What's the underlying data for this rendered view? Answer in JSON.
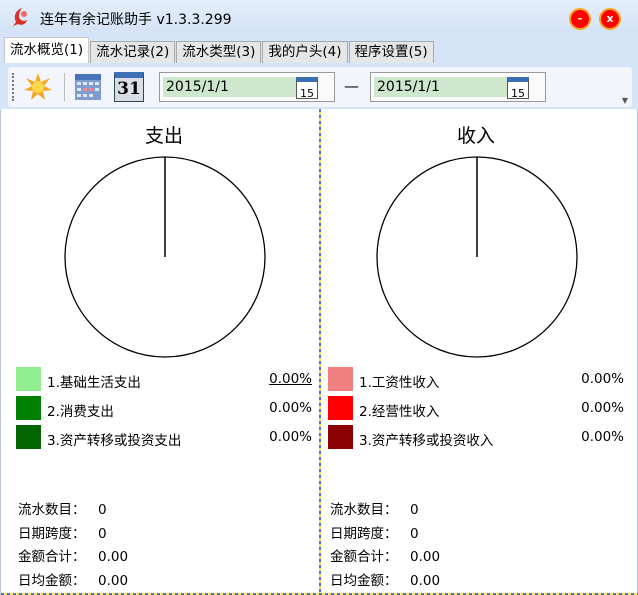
{
  "window": {
    "title": "连年有余记账助手 v1.3.3.299",
    "minimize": "-",
    "close": "x"
  },
  "tabs": [
    {
      "label": "流水概览(1)"
    },
    {
      "label": "流水记录(2)"
    },
    {
      "label": "流水类型(3)"
    },
    {
      "label": "我的户头(4)"
    },
    {
      "label": "程序设置(5)"
    }
  ],
  "toolbar": {
    "start_date": "2015/1/1",
    "end_date": "2015/1/1",
    "separator": "—",
    "cal_icon_text": "15",
    "cal31": "31"
  },
  "expense": {
    "title": "支出",
    "items": [
      {
        "label": "1.基础生活支出",
        "pct": "0.00%",
        "color": "#90ee90"
      },
      {
        "label": "2.消费支出",
        "pct": "0.00%",
        "color": "#008000"
      },
      {
        "label": "3.资产转移或投资支出",
        "pct": "0.00%",
        "color": "#006400"
      }
    ],
    "stats": [
      {
        "k": "流水数目：",
        "v": "0"
      },
      {
        "k": "日期跨度：",
        "v": "0"
      },
      {
        "k": "金额合计：",
        "v": "0.00"
      },
      {
        "k": "日均金额：",
        "v": "0.00"
      }
    ]
  },
  "income": {
    "title": "收入",
    "items": [
      {
        "label": "1.工资性收入",
        "pct": "0.00%",
        "color": "#f08080"
      },
      {
        "label": "2.经营性收入",
        "pct": "0.00%",
        "color": "#ff0000"
      },
      {
        "label": "3.资产转移或投资收入",
        "pct": "0.00%",
        "color": "#8b0000"
      }
    ],
    "stats": [
      {
        "k": "流水数目：",
        "v": "0"
      },
      {
        "k": "日期跨度：",
        "v": "0"
      },
      {
        "k": "金额合计：",
        "v": "0.00"
      },
      {
        "k": "日均金额：",
        "v": "0.00"
      }
    ]
  },
  "chart_data": [
    {
      "type": "pie",
      "title": "支出",
      "categories": [
        "1.基础生活支出",
        "2.消费支出",
        "3.资产转移或投资支出"
      ],
      "values": [
        0,
        0,
        0
      ]
    },
    {
      "type": "pie",
      "title": "收入",
      "categories": [
        "1.工资性收入",
        "2.经营性收入",
        "3.资产转移或投资收入"
      ],
      "values": [
        0,
        0,
        0
      ]
    }
  ]
}
